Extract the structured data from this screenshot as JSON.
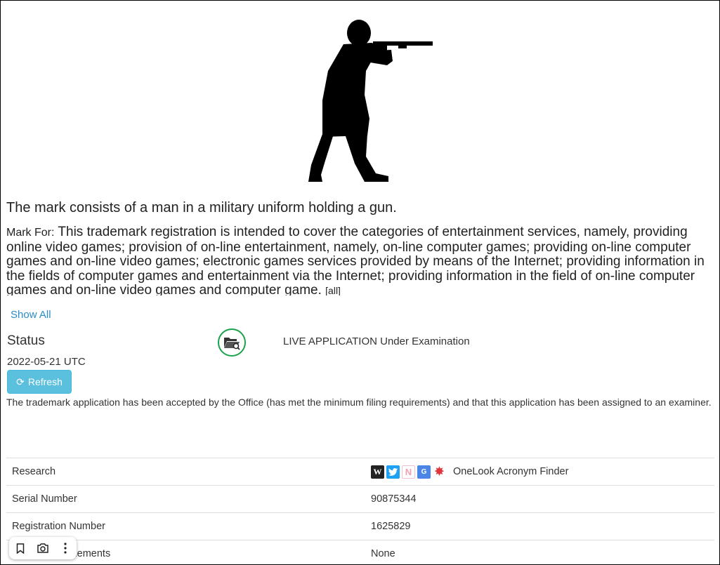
{
  "mark": {
    "description": "The mark consists of a man in a military uniform holding a gun.",
    "mark_for_label": "Mark For:",
    "mark_for_text": "This trademark registration is intended to cover the categories of entertainment services, namely, providing online video games; provision of on-line entertainment, namely, on-line computer games; providing on-line computer games and on-line video games; electronic games services provided by means of the Internet; providing information in the fields of computer games and entertainment via the Internet; providing information in the field of on-line computer games and on-line video games and computer game.",
    "all_link": "[all]",
    "show_all": "Show All"
  },
  "status": {
    "heading": "Status",
    "text": "LIVE APPLICATION Under Examination",
    "date": "2022-05-21 UTC",
    "refresh_label": "Refresh",
    "explanation": "The trademark application has been accepted by the Office (has met the minimum filing requirements) and that this application has been assigned to an examiner.",
    "icon_color": "#1aa34a"
  },
  "table": {
    "rows": [
      {
        "key": "Research",
        "value": "OneLook Acronym Finder"
      },
      {
        "key": "Serial Number",
        "value": "90875344"
      },
      {
        "key": "Registration Number",
        "value": "1625829"
      },
      {
        "key": "Mark Literal Elements",
        "value": "None"
      }
    ],
    "research_icons": [
      "wikipedia-icon",
      "twitter-icon",
      "news-icon",
      "google-translate-icon",
      "onelook-icon"
    ]
  }
}
